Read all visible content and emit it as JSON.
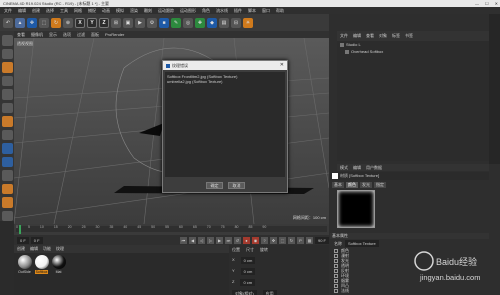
{
  "titlebar": {
    "title": "CINEMA 4D R19.024 Studio (RC - R19) - [未标题 1 *] - 主要",
    "controls": [
      "—",
      "☐",
      "✕"
    ]
  },
  "menubar": [
    "文件",
    "编辑",
    "创建",
    "选择",
    "工具",
    "网格",
    "捕捉",
    "动画",
    "模拟",
    "渲染",
    "雕刻",
    "运动跟踪",
    "运动图形",
    "角色",
    "流水线",
    "插件",
    "脚本",
    "窗口",
    "帮助"
  ],
  "toolbar": {
    "xyz": [
      "X",
      "Y",
      "Z"
    ]
  },
  "viewport": {
    "menus": [
      "查看",
      "摄像机",
      "显示",
      "选项",
      "过滤",
      "面板",
      "ProRender"
    ],
    "label": "透视视图",
    "grid_distance": "网格间距：100 cm"
  },
  "dialog": {
    "title": "纹理错误",
    "lines": [
      "Softbox Frontlitm2.jpg (Softbox Texture)",
      "umbrella2.jpg (Softbox Texture)"
    ],
    "ok_label": "确定",
    "cancel_label": "取消"
  },
  "objects": {
    "menus": [
      "文件",
      "编辑",
      "查看",
      "对象",
      "标签",
      "书签"
    ],
    "items": [
      "Studio L",
      "Overhead Softbox"
    ]
  },
  "material_panel": {
    "menus": [
      "模式",
      "编辑",
      "用户数据"
    ],
    "name": "材质 [Softbox Texture]",
    "tabs": [
      "基本",
      "颜色",
      "发光",
      "指定"
    ],
    "active_tab": "颜色",
    "attr_header": "基本属性",
    "attr_name_label": "名称",
    "attr_name_value": "Softbox Texture",
    "attr_rows": [
      "颜色",
      "漫射",
      "发光",
      "透明",
      "反射",
      "环境",
      "烟雾",
      "凹凸",
      "法线",
      "Alpha"
    ]
  },
  "timeline": {
    "ticks": [
      "0",
      "5",
      "10",
      "15",
      "20",
      "25",
      "30",
      "35",
      "40",
      "45",
      "50",
      "55",
      "60",
      "65",
      "70",
      "75",
      "80",
      "85",
      "90"
    ],
    "start": "0 F",
    "end": "90 F",
    "current": "0 F"
  },
  "material_manager": {
    "menus": [
      "创建",
      "编辑",
      "功能",
      "纹理"
    ],
    "materials": [
      {
        "label": "OutSide",
        "color": "#8a8a8a"
      },
      {
        "label": "Softbox",
        "color": "#f2f2f2",
        "selected": true
      },
      {
        "label": "Mat",
        "color": "#111111"
      }
    ]
  },
  "coordinates": {
    "rows": [
      "位置",
      "尺寸",
      "旋转"
    ],
    "axes": [
      "X",
      "Y",
      "Z"
    ],
    "values": [
      "0 cm",
      "0 cm",
      "0 cm"
    ],
    "mode": "对象(相对)",
    "apply": "应用"
  },
  "watermark": {
    "text1": "Baidu经验",
    "text2": "jingyan.baidu.com"
  }
}
